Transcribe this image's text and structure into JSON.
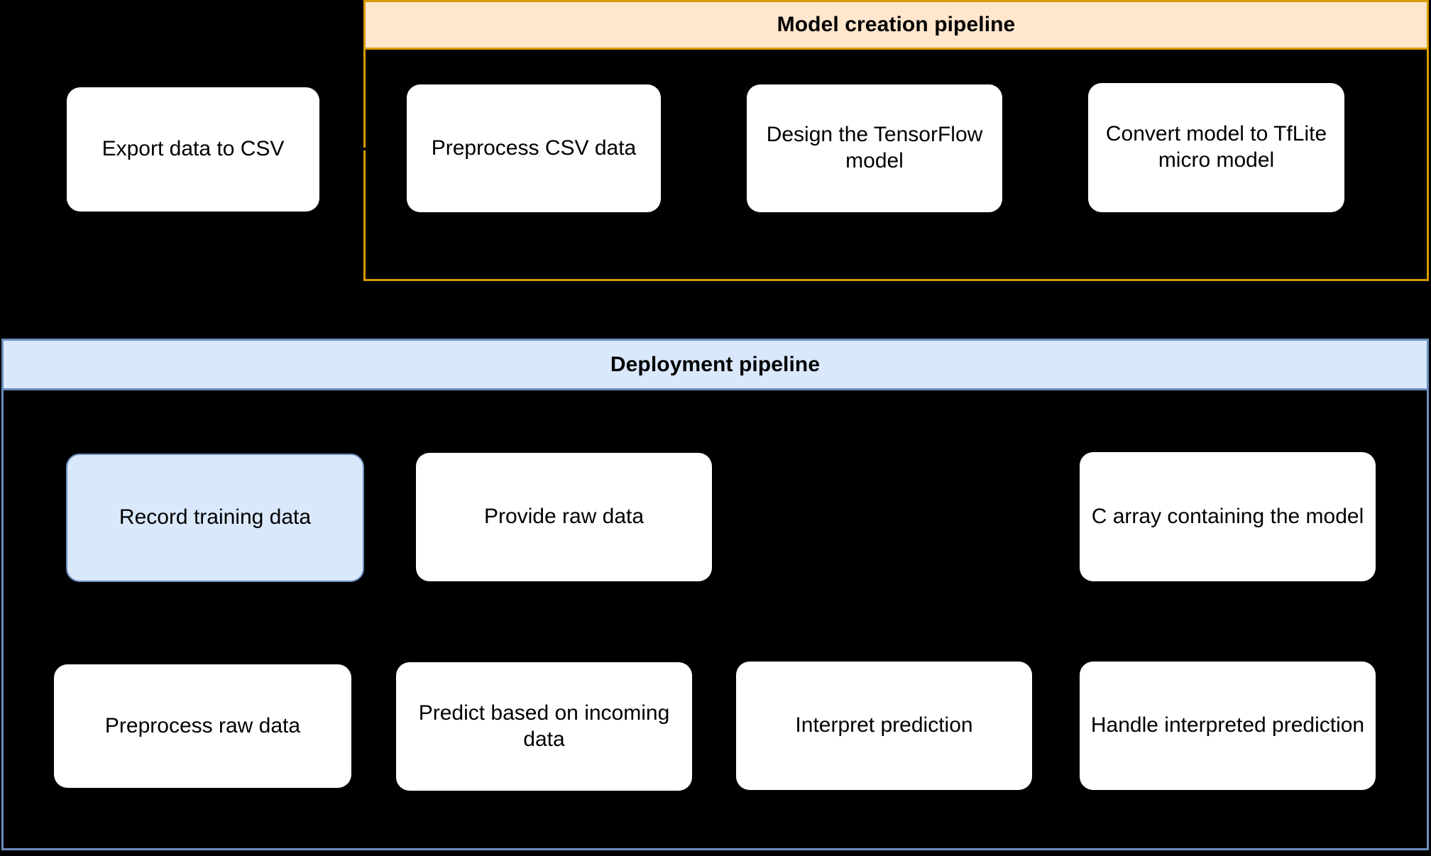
{
  "diagram": {
    "background_color": "#000000",
    "groups": [
      {
        "id": "model-creation",
        "title": "Model creation pipeline",
        "fill_color": "#ffe6cc",
        "border_color": "#d79b00"
      },
      {
        "id": "deployment",
        "title": "Deployment pipeline",
        "fill_color": "#dae8fc",
        "border_color": "#6c8ebf"
      }
    ],
    "nodes": [
      {
        "id": "export-data-to-csv",
        "label": "Export data to CSV",
        "group": null,
        "fill_color": "#ffffff",
        "highlighted": false
      },
      {
        "id": "preprocess-csv-data",
        "label": "Preprocess CSV data",
        "group": "model-creation",
        "fill_color": "#ffffff",
        "highlighted": false
      },
      {
        "id": "design-tensorflow-model",
        "label": "Design the TensorFlow model",
        "group": "model-creation",
        "fill_color": "#ffffff",
        "highlighted": false
      },
      {
        "id": "convert-model-tflite",
        "label": "Convert model to TfLite micro model",
        "group": "model-creation",
        "fill_color": "#ffffff",
        "highlighted": false
      },
      {
        "id": "record-training-data",
        "label": "Record training data",
        "group": "deployment",
        "fill_color": "#dae8fc",
        "highlighted": true
      },
      {
        "id": "provide-raw-data",
        "label": "Provide raw data",
        "group": "deployment",
        "fill_color": "#ffffff",
        "highlighted": false
      },
      {
        "id": "c-array-containing-model",
        "label": "C array containing the model",
        "group": "deployment",
        "fill_color": "#ffffff",
        "highlighted": false
      },
      {
        "id": "preprocess-raw-data",
        "label": "Preprocess raw data",
        "group": "deployment",
        "fill_color": "#ffffff",
        "highlighted": false
      },
      {
        "id": "predict-incoming-data",
        "label": "Predict based on incoming data",
        "group": "deployment",
        "fill_color": "#ffffff",
        "highlighted": false
      },
      {
        "id": "interpret-prediction",
        "label": "Interpret prediction",
        "group": "deployment",
        "fill_color": "#ffffff",
        "highlighted": false
      },
      {
        "id": "handle-interpreted-prediction",
        "label": "Handle interpreted prediction",
        "group": "deployment",
        "fill_color": "#ffffff",
        "highlighted": false
      }
    ],
    "edges": [
      {
        "id": "export-to-preprocess",
        "from": "export-data-to-csv",
        "to": "preprocess-csv-data",
        "color": "#000000"
      }
    ]
  }
}
